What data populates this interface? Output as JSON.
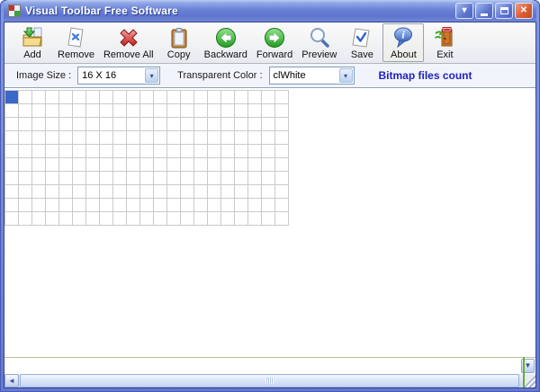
{
  "window": {
    "title": "Visual Toolbar Free Software"
  },
  "titlebar": {
    "rollup_glyph": "▾",
    "close_glyph": "✕"
  },
  "toolbar": {
    "buttons": [
      {
        "label": "Add",
        "icon": "add-folder-icon"
      },
      {
        "label": "Remove",
        "icon": "remove-page-icon"
      },
      {
        "label": "Remove All",
        "icon": "remove-all-icon"
      },
      {
        "label": "Copy",
        "icon": "copy-clipboard-icon"
      },
      {
        "label": "Backward",
        "icon": "backward-arrow-icon"
      },
      {
        "label": "Forward",
        "icon": "forward-arrow-icon"
      },
      {
        "label": "Preview",
        "icon": "preview-magnifier-icon"
      },
      {
        "label": "Save",
        "icon": "save-page-icon"
      },
      {
        "label": "About",
        "icon": "about-balloon-icon",
        "active": true
      },
      {
        "label": "Exit",
        "icon": "exit-door-icon"
      }
    ]
  },
  "controls_row": {
    "image_size_label": "Image Size :",
    "image_size_value": "16 X 16",
    "transparent_color_label": "Transparent Color :",
    "transparent_color_value": "clWhite",
    "bitmap_count_label": "Bitmap files count"
  },
  "grid": {
    "rows": 10,
    "cols": 21,
    "cell_size_px": 15,
    "selected": {
      "row": 0,
      "col": 0
    },
    "selected_color": "#3A68C8",
    "line_color": "#CACACA"
  },
  "icons": {
    "combo_arrow": "▾",
    "scroll_left_arrow": "◄",
    "scroll_down_arrow": "▼"
  },
  "colors": {
    "titlebar_gradient_top": "#BACBF2",
    "titlebar_gradient_bottom": "#6579D0",
    "accent_text": "#2222BE",
    "selected_cell": "#3A68C8"
  }
}
